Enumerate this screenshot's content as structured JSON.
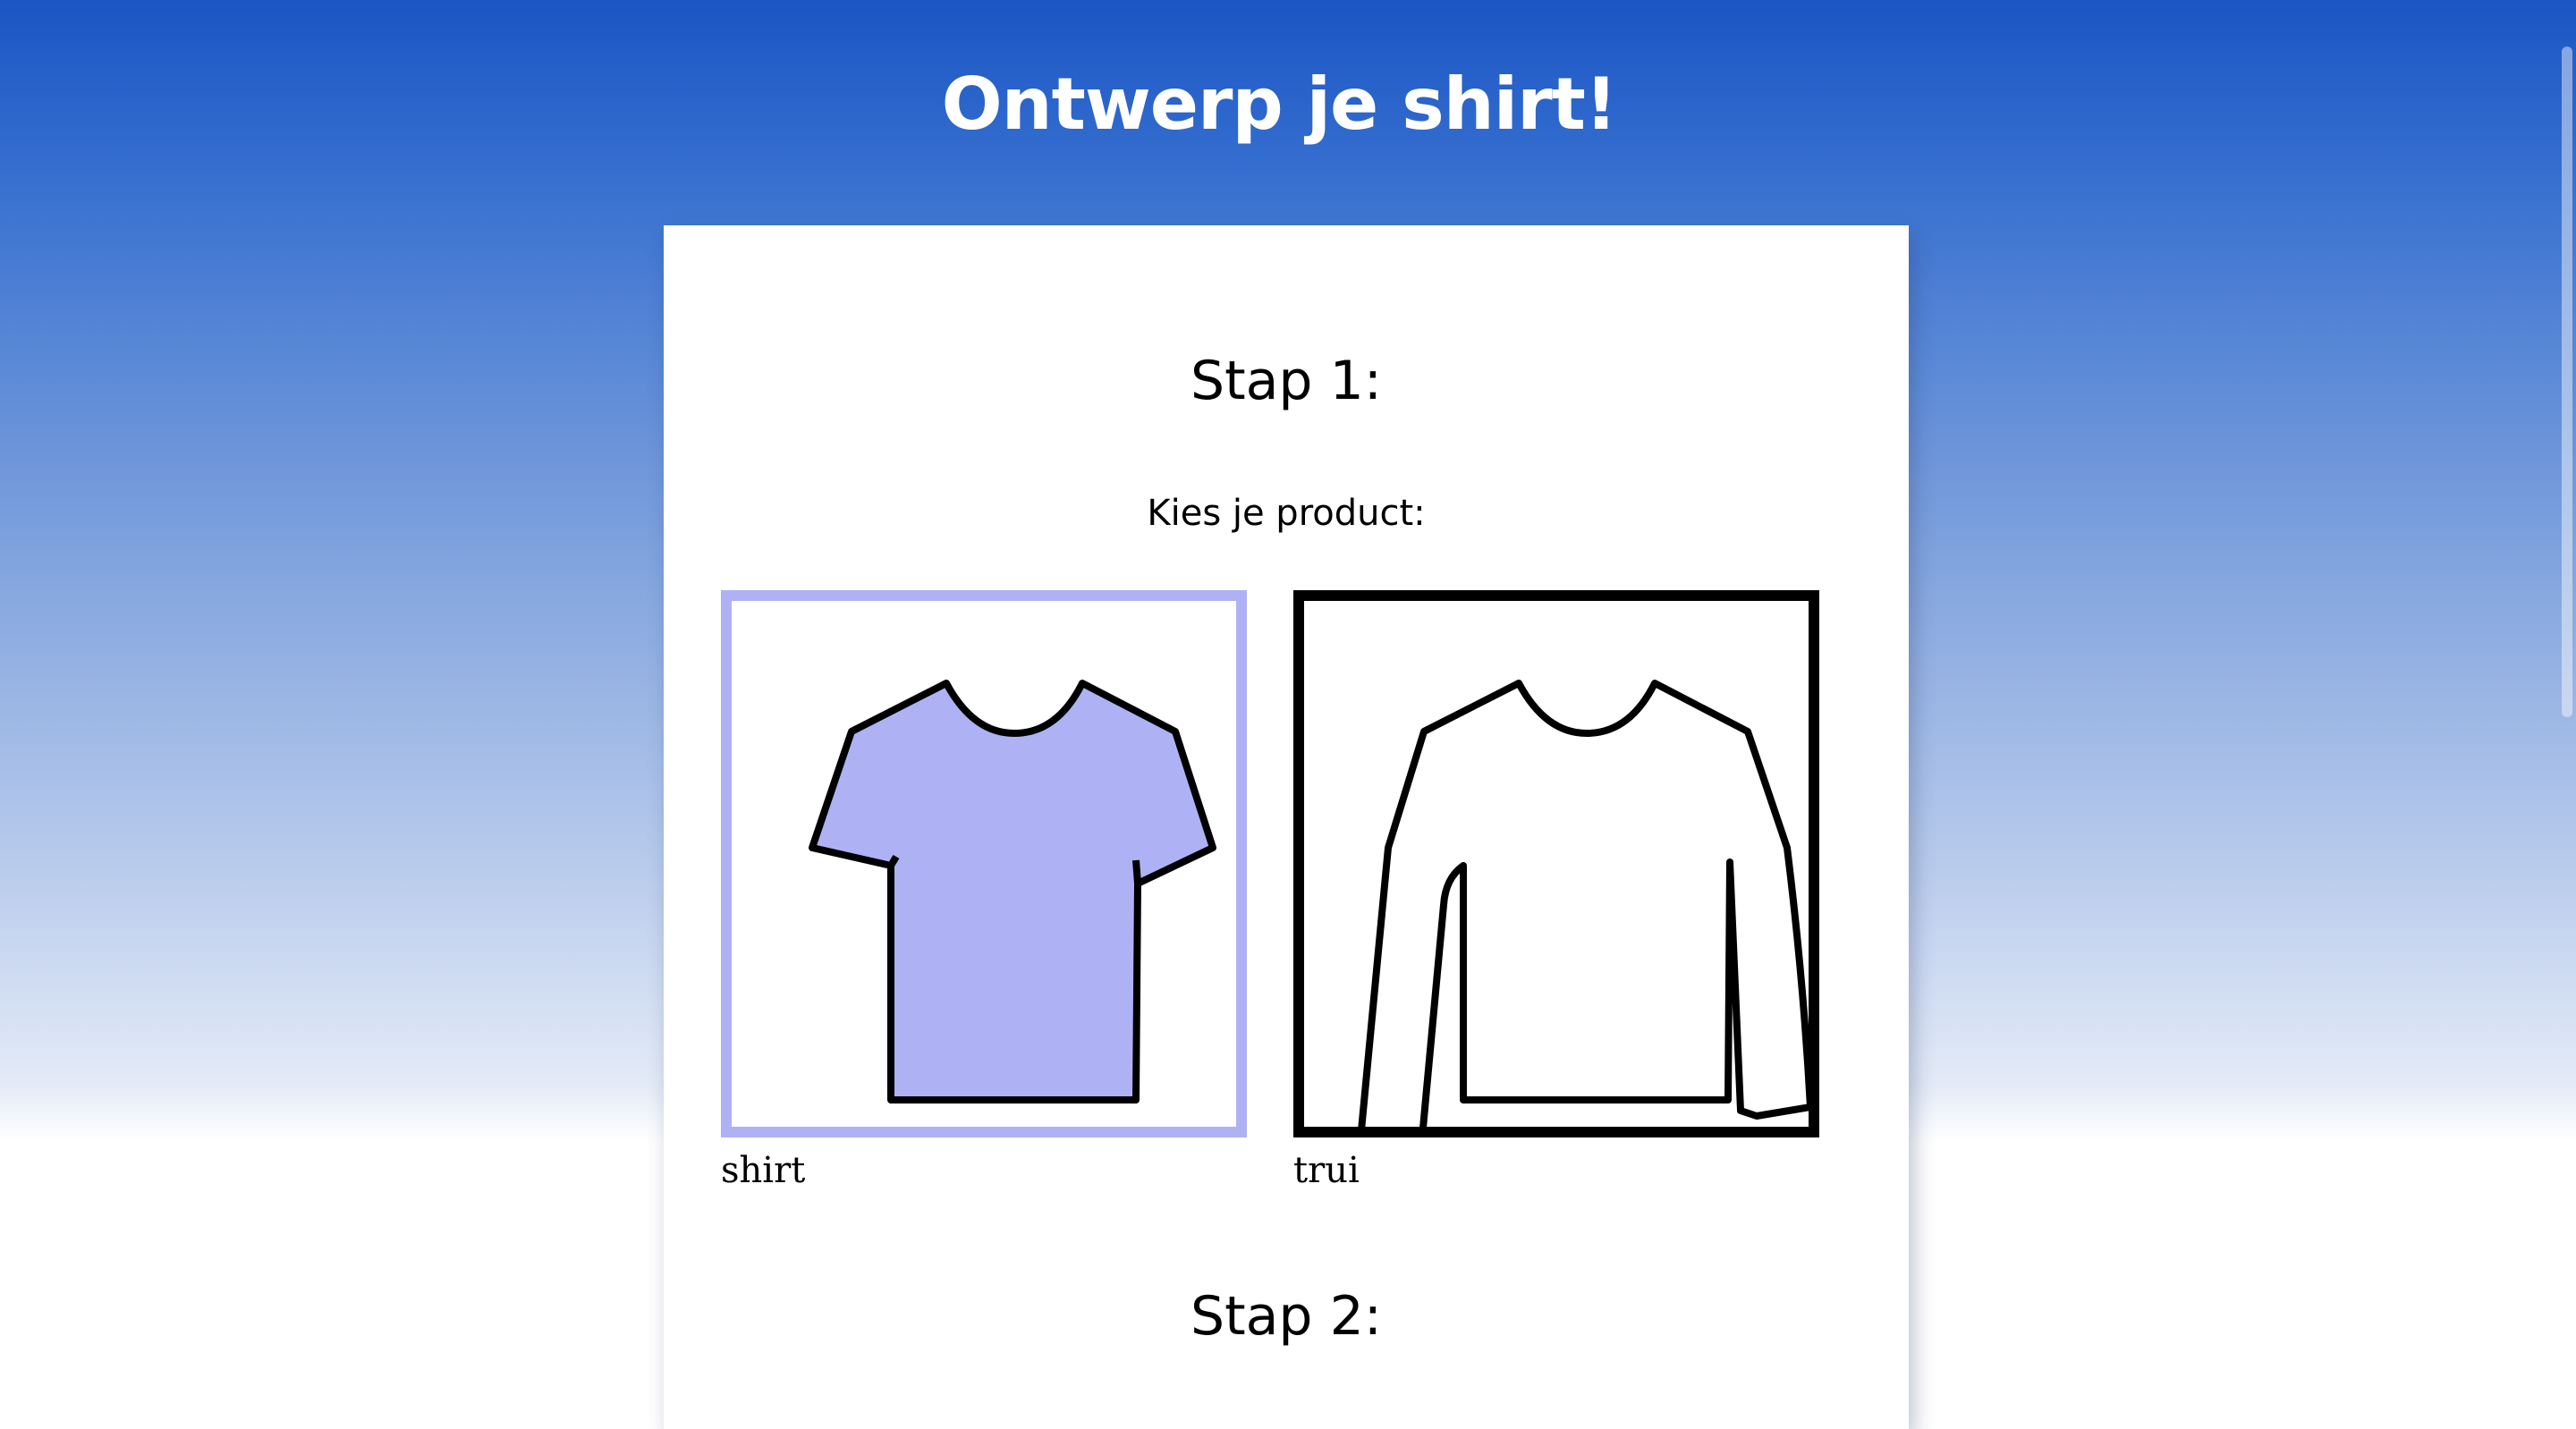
{
  "header": {
    "title": "Ontwerp je shirt!"
  },
  "steps": [
    {
      "heading": "Stap 1:",
      "instruction": "Kies je product:",
      "products": [
        {
          "label": "shirt",
          "icon": "t-shirt-icon",
          "selected": true,
          "fill_color": "#aeb2f4",
          "border_color": "#aeb2f4"
        },
        {
          "label": "trui",
          "icon": "sweater-icon",
          "selected": false,
          "fill_color": "#ffffff",
          "border_color": "#000000"
        }
      ]
    },
    {
      "heading": "Stap 2:"
    }
  ],
  "colors": {
    "header_gradient_top": "#1a55c4",
    "header_gradient_bottom": "#ffffff",
    "panel_background": "#ffffff",
    "selected_accent": "#aeb2f4"
  }
}
